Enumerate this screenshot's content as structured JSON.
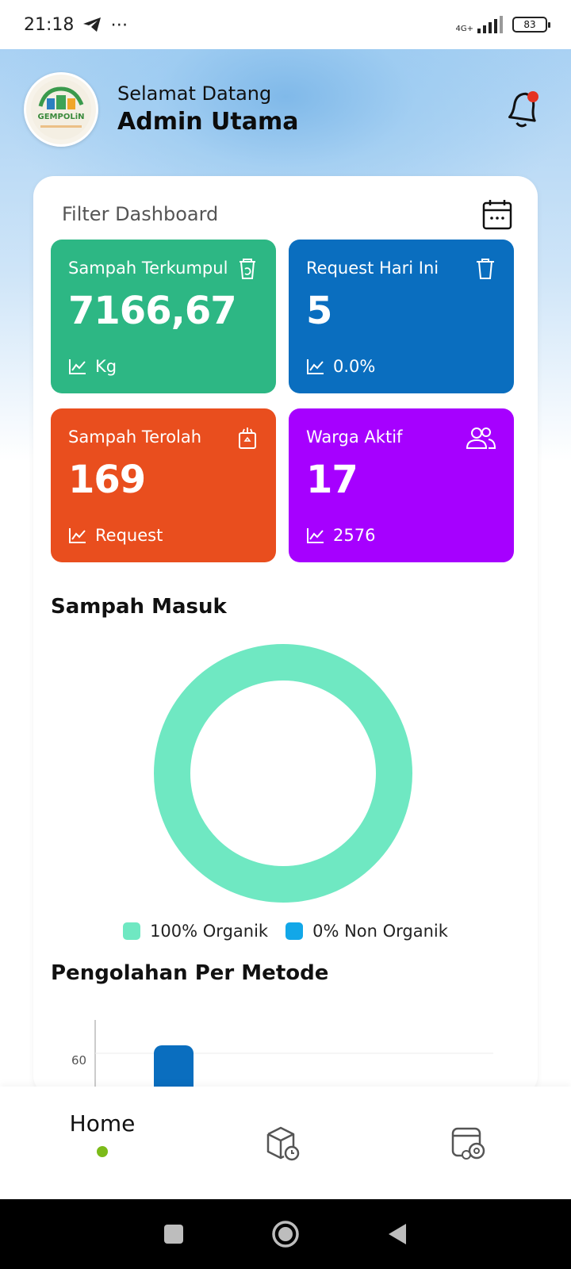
{
  "status_bar": {
    "time": "21:18",
    "network": "4G+",
    "battery": "83"
  },
  "header": {
    "greeting": "Selamat Datang",
    "user_name": "Admin Utama",
    "logo_text": "GEMPOLiN"
  },
  "filter": {
    "label": "Filter Dashboard"
  },
  "stats": [
    {
      "title": "Sampah Terkumpul",
      "value": "7166,67",
      "footer": "Kg",
      "color": "#2db784",
      "icon": "recycle-bin-icon"
    },
    {
      "title": "Request Hari Ini",
      "value": "5",
      "footer": "0.0%",
      "color": "#0a6ebf",
      "icon": "trash-icon"
    },
    {
      "title": "Sampah Terolah",
      "value": "169",
      "footer": "Request",
      "color": "#e94e1e",
      "icon": "recycle-box-icon"
    },
    {
      "title": "Warga Aktif",
      "value": "17",
      "footer": "2576",
      "color": "#a600ff",
      "icon": "users-icon"
    }
  ],
  "sampah_masuk": {
    "title": "Sampah Masuk",
    "legend": [
      {
        "label": "100% Organik",
        "color": "#6fe8c2"
      },
      {
        "label": "0% Non Organik",
        "color": "#12a7e8"
      }
    ]
  },
  "pengolahan": {
    "title": "Pengolahan Per Metode",
    "tick": "60",
    "bar_color": "#0a6ebf"
  },
  "chart_data": [
    {
      "type": "pie",
      "title": "Sampah Masuk",
      "categories": [
        "Organik",
        "Non Organik"
      ],
      "values": [
        100,
        0
      ]
    },
    {
      "type": "bar",
      "title": "Pengolahan Per Metode",
      "yticks": [
        60
      ]
    }
  ],
  "nav": {
    "home_label": "Home"
  }
}
